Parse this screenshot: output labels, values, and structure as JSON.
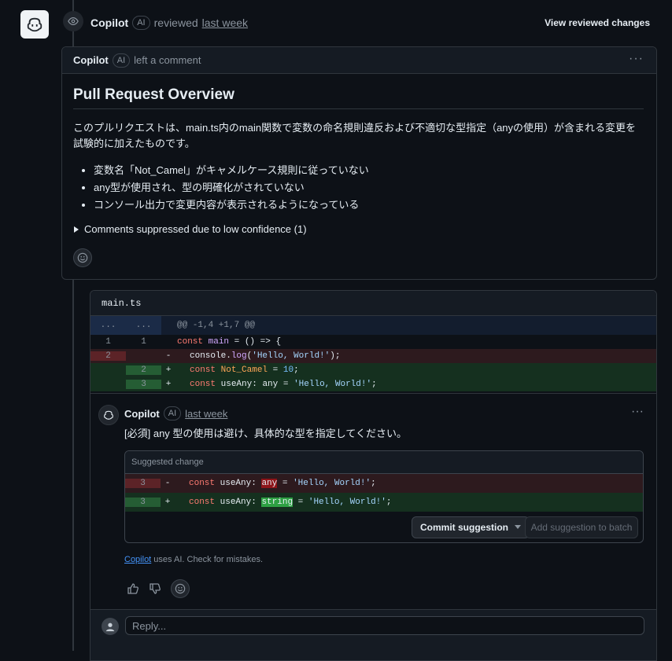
{
  "review": {
    "author": "Copilot",
    "ai_badge": "AI",
    "action": "reviewed",
    "time": "last week",
    "view_changes": "View reviewed changes"
  },
  "comment": {
    "author": "Copilot",
    "ai_badge": "AI",
    "action": "left a comment",
    "menu": "···",
    "title": "Pull Request Overview",
    "paragraph": "このプルリクエストは、main.ts内のmain関数で変数の命名規則違反および不適切な型指定（anyの使用）が含まれる変更を試験的に加えたものです。",
    "bullets": [
      "変数名「Not_Camel」がキャメルケース規則に従っていない",
      "any型が使用され、型の明確化がされていない",
      "コンソール出力で変更内容が表示されるようになっている"
    ],
    "suppressed": "Comments suppressed due to low confidence (1)"
  },
  "file": {
    "name": "main.ts",
    "hunk_left": "...",
    "hunk_right": "...",
    "hunk": "@@ -1,4 +1,7 @@",
    "lines": [
      {
        "old": "1",
        "new": "1",
        "sign": "",
        "type": "ctx"
      },
      {
        "old": "2",
        "new": "",
        "sign": "-",
        "type": "del"
      },
      {
        "old": "",
        "new": "2",
        "sign": "+",
        "type": "add"
      },
      {
        "old": "",
        "new": "3",
        "sign": "+",
        "type": "add"
      }
    ],
    "code": {
      "l1_kw": "const",
      "l1_name": "main",
      "l1_rest": " = () => {",
      "l2_obj": "console.",
      "l2_fn": "log",
      "l2_open": "(",
      "l2_str": "'Hello, World!'",
      "l2_close": ");",
      "l3_kw": "const",
      "l3_var": "Not_Camel",
      "l3_eq": " = ",
      "l3_num": "10",
      "l3_end": ";",
      "l4_kw": "const",
      "l4_name": "useAny: ",
      "l4_type": "any",
      "l4_eq": " = ",
      "l4_str": "'Hello, World!'",
      "l4_end": ";"
    }
  },
  "inline_comment": {
    "author": "Copilot",
    "ai_badge": "AI",
    "time": "last week",
    "menu": "···",
    "body": "[必須] any 型の使用は避け、具体的な型を指定してください。",
    "suggested_label": "Suggested change",
    "del_line": {
      "num": "3",
      "sign": "-",
      "kw": "const",
      "name": "useAny: ",
      "type": "any",
      "eq": " = ",
      "str": "'Hello, World!'",
      "end": ";"
    },
    "add_line": {
      "num": "3",
      "sign": "+",
      "kw": "const",
      "name": "useAny: ",
      "type": "string",
      "eq": " = ",
      "str": "'Hello, World!'",
      "end": ";"
    },
    "commit_button": "Commit suggestion",
    "batch_button": "Add suggestion to batch",
    "disclaimer_link": "Copilot",
    "disclaimer_text": " uses AI. Check for mistakes."
  },
  "reply": {
    "placeholder": "Reply..."
  },
  "icons": {
    "avatar": "copilot-icon",
    "review": "eye-icon",
    "reactions": [
      "thumbs-up-icon",
      "thumbs-down-icon",
      "smiley-icon"
    ],
    "details": "triangle-right-icon",
    "dropdown": "caret-down-icon"
  },
  "colors": {
    "background": "#0d1117",
    "deleted_line": "#2d1a1e",
    "added_line": "#15301f",
    "link": "#4493f8"
  }
}
